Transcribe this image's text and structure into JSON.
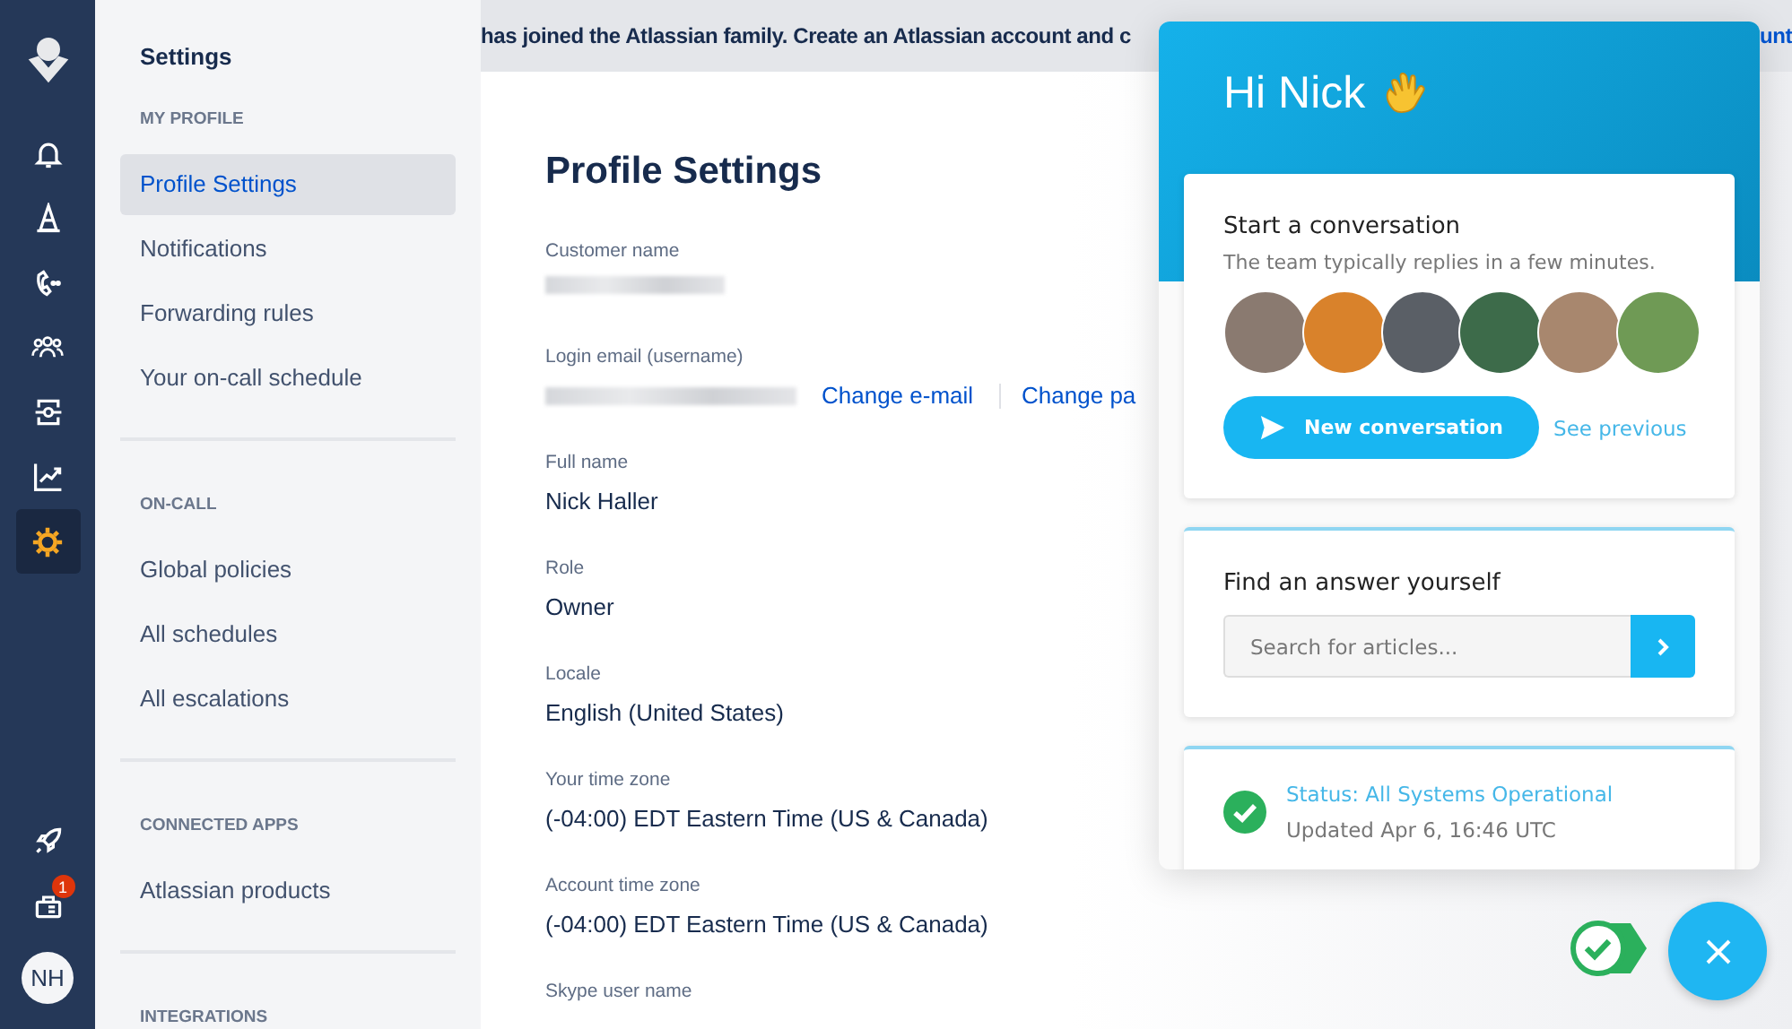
{
  "rail": {
    "top_items": [
      {
        "kind": "bell",
        "selected": false
      },
      {
        "kind": "cone",
        "selected": false
      },
      {
        "kind": "phone",
        "selected": false
      },
      {
        "kind": "people",
        "selected": false
      },
      {
        "kind": "schedule",
        "selected": false
      },
      {
        "kind": "chart",
        "selected": false
      },
      {
        "kind": "gear",
        "selected": true
      }
    ],
    "bottom_items": [
      {
        "kind": "rocket"
      },
      {
        "kind": "apps",
        "badge": "1"
      }
    ],
    "avatar": "NH"
  },
  "sidebar": {
    "title": "Settings",
    "sections": [
      {
        "heading": "MY PROFILE",
        "items": [
          {
            "label": "Profile Settings",
            "selected": true
          },
          {
            "label": "Notifications",
            "selected": false
          },
          {
            "label": "Forwarding rules",
            "selected": false
          },
          {
            "label": "Your on-call schedule",
            "selected": false
          }
        ]
      },
      {
        "heading": "ON-CALL",
        "items": [
          {
            "label": "Global policies",
            "selected": false
          },
          {
            "label": "All schedules",
            "selected": false
          },
          {
            "label": "All escalations",
            "selected": false
          }
        ]
      },
      {
        "heading": "CONNECTED APPS",
        "items": [
          {
            "label": "Atlassian products",
            "selected": false
          }
        ]
      },
      {
        "heading": "INTEGRATIONS"
      }
    ]
  },
  "banner": {
    "text": "has joined the Atlassian family. Create an Atlassian account and c",
    "text_end": "unt"
  },
  "main": {
    "title": "Profile Settings",
    "fields": [
      {
        "kind": "redacted",
        "label": "Customer name"
      },
      {
        "kind": "redacted",
        "label": "Login email (username)",
        "links": [
          "Change e-mail",
          "Change pa"
        ]
      },
      {
        "kind": "text",
        "label": "Full name",
        "value": "Nick Haller"
      },
      {
        "kind": "text",
        "label": "Role",
        "value": "Owner"
      },
      {
        "kind": "text",
        "label": "Locale",
        "value": "English (United States)"
      },
      {
        "kind": "text",
        "label": "Your time zone",
        "value": "(-04:00) EDT Eastern Time (US & Canada)"
      },
      {
        "kind": "text",
        "label": "Account time zone",
        "value": "(-04:00) EDT Eastern Time (US & Canada)"
      },
      {
        "kind": "text",
        "label": "Skype user name"
      }
    ]
  },
  "chat": {
    "greeting": "Hi Nick",
    "conversation": {
      "title": "Start a conversation",
      "subtitle": "The team typically replies in a few minutes.",
      "team_avatars": [
        {
          "color": "#8a7a70"
        },
        {
          "color": "#d9822b"
        },
        {
          "color": "#5a5f66"
        },
        {
          "color": "#3d6b4a"
        },
        {
          "color": "#a8876e"
        },
        {
          "color": "#6f9a55"
        }
      ],
      "button": "New conversation",
      "link": "See previous"
    },
    "search": {
      "title": "Find an answer yourself",
      "placeholder": "Search for articles..."
    },
    "status": {
      "title": "Status: All Systems Operational",
      "updated": "Updated Apr 6, 16:46 UTC"
    }
  }
}
